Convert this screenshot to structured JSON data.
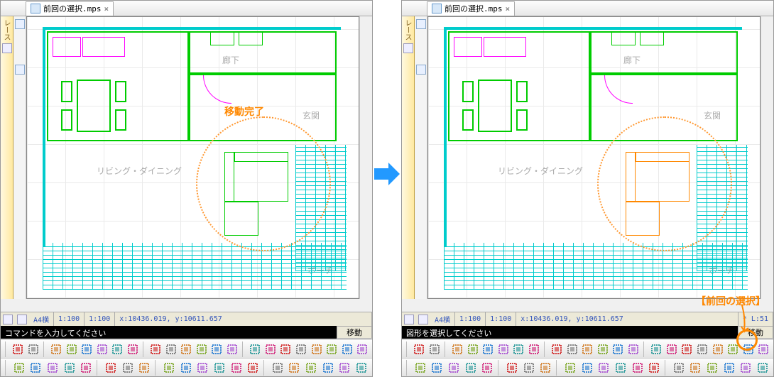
{
  "tab": {
    "title": "前回の選択.mps"
  },
  "sidebar_label": "レース",
  "labels": {
    "corridor": "廊下",
    "entrance": "玄関",
    "living": "リビング・ダイニング",
    "porch": "ポーチ"
  },
  "annotation": {
    "move_complete": "移動完了",
    "prev_selection": "【前回の選択】"
  },
  "status": {
    "paper": "A4横",
    "scale1": "1:100",
    "scale2": "1:100",
    "coord": "x:10436.019, y:10611.657",
    "layer": "* L:51"
  },
  "cmd": {
    "left": "コマンドを入力してください",
    "right": "図形を選択してください",
    "mode": "移動"
  }
}
